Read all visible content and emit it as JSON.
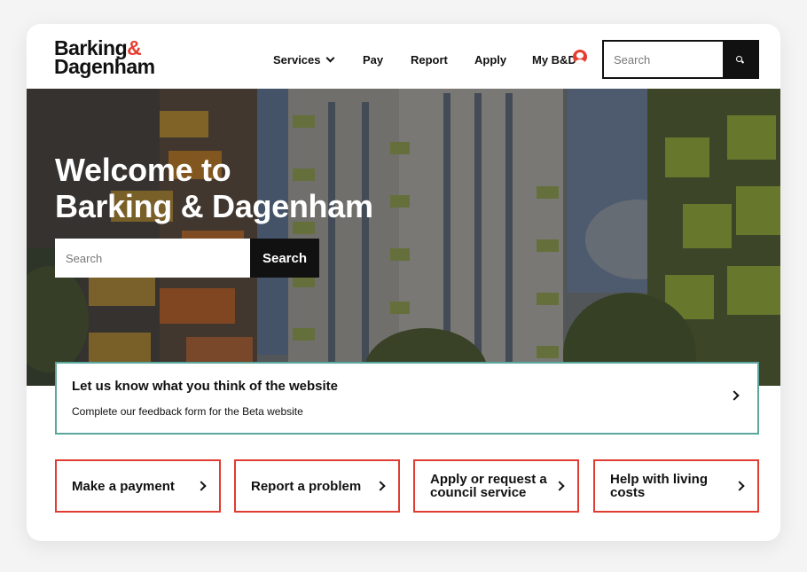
{
  "logo": {
    "line1": "Barking",
    "amp": "&",
    "line2": "Dagenham"
  },
  "nav": {
    "services": "Services",
    "pay": "Pay",
    "report": "Report",
    "apply": "Apply",
    "my_account": "My B&D"
  },
  "header_search": {
    "placeholder": "Search"
  },
  "hero": {
    "title_line1": "Welcome to",
    "title_line2": "Barking & Dagenham",
    "search_placeholder": "Search",
    "search_button": "Search"
  },
  "feedback": {
    "title": "Let us know what you think of the website",
    "subtitle": "Complete our feedback form for the Beta website"
  },
  "quick_links": [
    {
      "label": "Make a payment"
    },
    {
      "label": "Report a problem"
    },
    {
      "label": "Apply or request a council service"
    },
    {
      "label": "Help with living costs"
    }
  ],
  "colors": {
    "brand_red": "#e63c2f",
    "feedback_border": "#5ba79d",
    "quick_link_border": "#e03c31"
  }
}
